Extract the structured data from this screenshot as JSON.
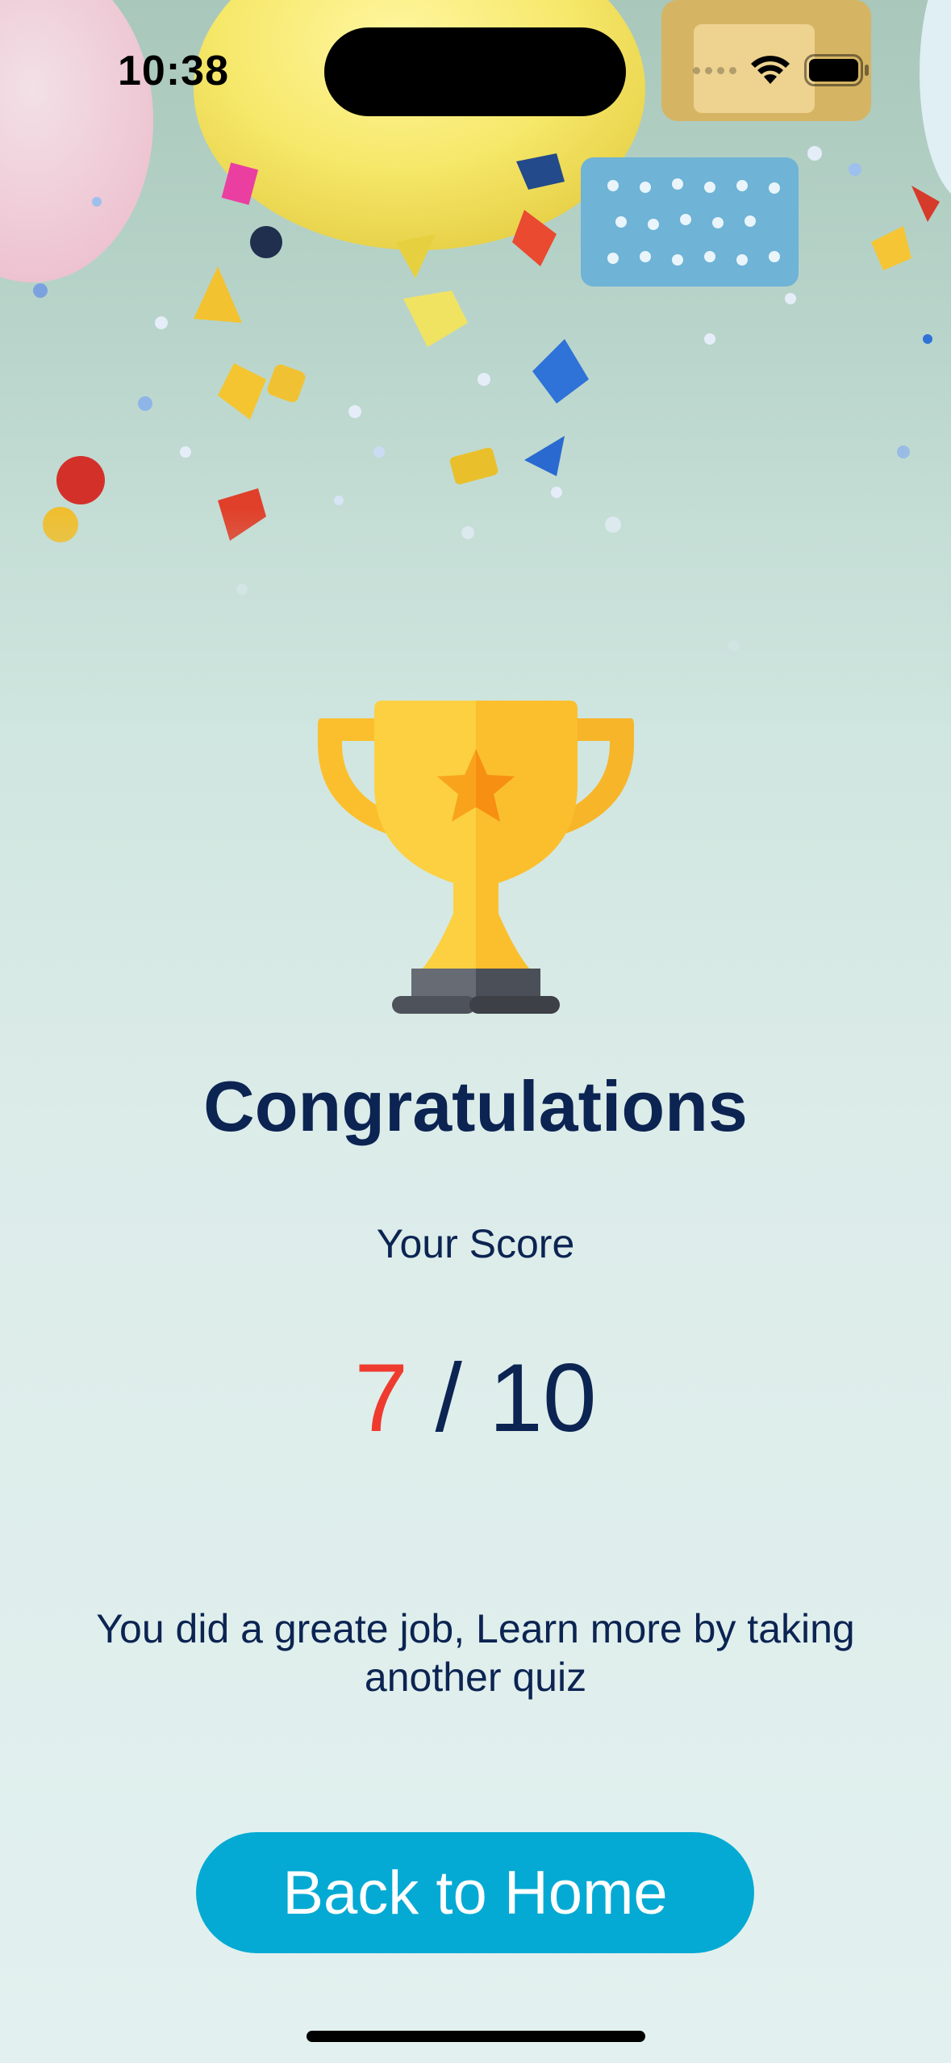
{
  "status_bar": {
    "time": "10:38",
    "icons": [
      "signal-dots-icon",
      "wifi-icon",
      "battery-icon"
    ]
  },
  "background": {
    "decoration": "balloons-and-confetti"
  },
  "result": {
    "trophy_icon": "trophy-icon",
    "title": "Congratulations",
    "score_label": "Your Score",
    "score_earned": "7",
    "score_separator": " / ",
    "score_total": "10",
    "message": "You did a greate job, Learn more by taking another quiz"
  },
  "actions": {
    "back_home_label": "Back to Home"
  },
  "colors": {
    "primary_text": "#0c2452",
    "score_highlight": "#ef3b2f",
    "button": "#04aad3",
    "trophy_gold": "#fbbf2d"
  }
}
